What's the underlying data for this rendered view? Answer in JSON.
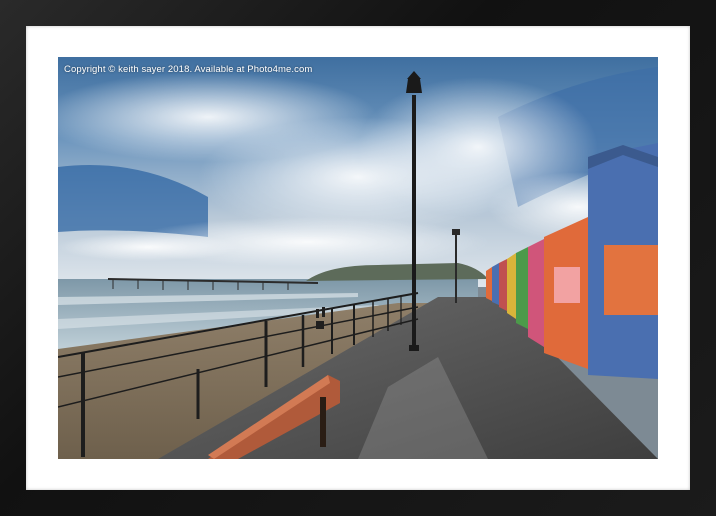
{
  "watermark": {
    "text": "Copyright  © keith sayer  2018. Available at Photo4me.com"
  },
  "colors": {
    "frame": "#1a1a1a",
    "mount": "#ffffff",
    "sky_blue": "#2f6fae",
    "sea": "#9fb7c4",
    "sand": "#8a7a62",
    "promenade": "#5a5a5a",
    "hut_blue": "#4a6fb0",
    "hut_orange": "#e06a3a",
    "hut_pink": "#d0557a",
    "hut_green": "#4c9a4a",
    "hut_yellow": "#d9b43a",
    "bench": "#b05a3a"
  }
}
